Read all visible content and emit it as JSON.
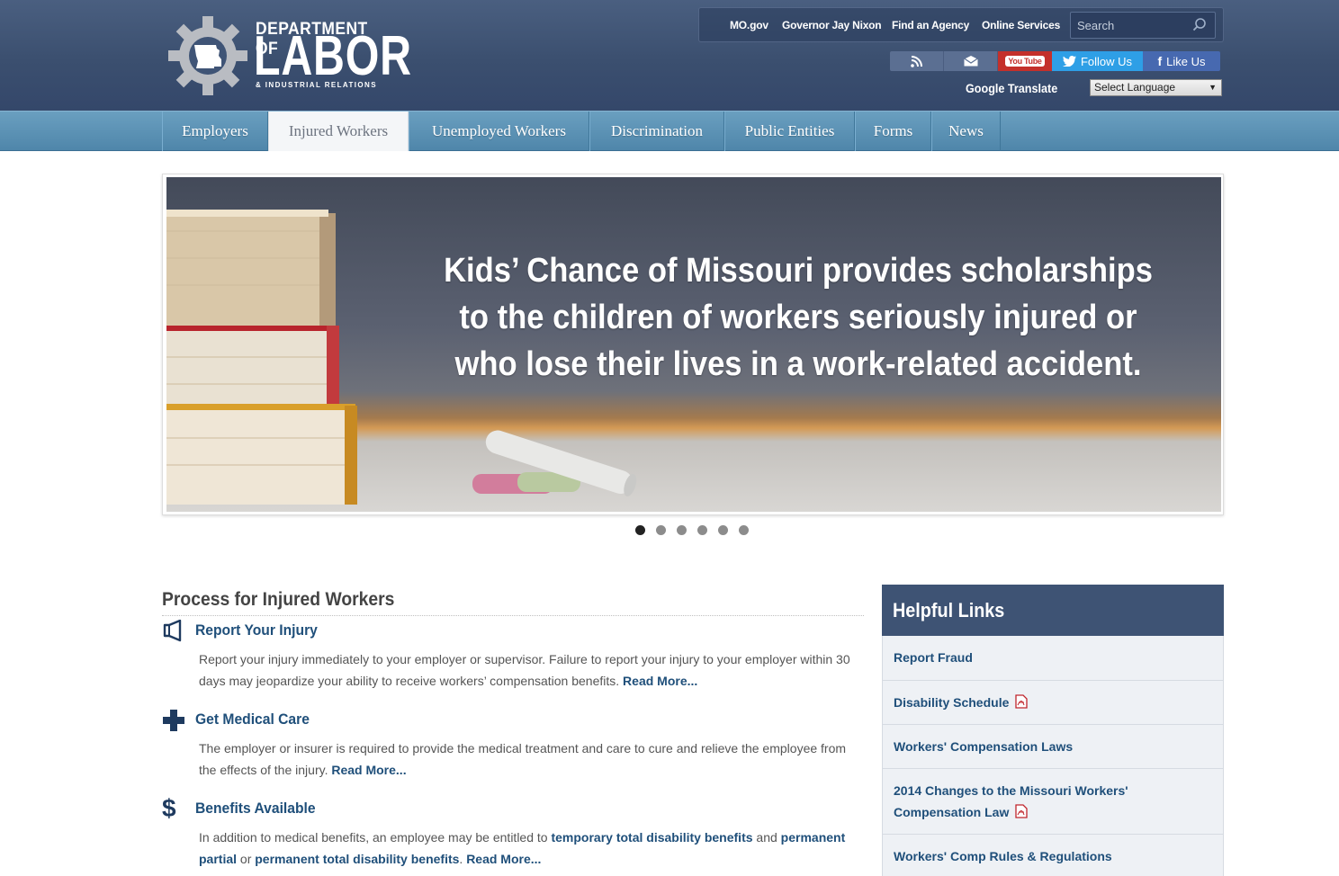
{
  "header": {
    "logo": {
      "line1": "DEPARTMENT OF",
      "line2": "LABOR",
      "line3": "& INDUSTRIAL RELATIONS"
    },
    "top_links": [
      "MO.gov",
      "Governor Jay Nixon",
      "Find an Agency",
      "Online Services"
    ],
    "search": {
      "placeholder": "Search"
    },
    "social": {
      "youtube_label": "You Tube",
      "twitter_label": "Follow Us",
      "facebook_label": "Like Us"
    },
    "translate": {
      "label": "Google Translate",
      "select_value": "Select Language"
    }
  },
  "nav": {
    "items": [
      "Employers",
      "Injured Workers",
      "Unemployed Workers",
      "Discrimination",
      "Public Entities",
      "Forms",
      "News"
    ],
    "active_index": 1
  },
  "slider": {
    "text_lines": [
      "Kids’ Chance of Missouri provides scholarships",
      "to the children of workers seriously injured or",
      "who lose their lives in a work-related accident."
    ],
    "slide_count": 6,
    "active_slide": 1
  },
  "main": {
    "title": "Process for Injured Workers",
    "items": [
      {
        "icon": "megaphone-icon",
        "heading": "Report Your Injury",
        "body": "Report your injury immediately to your employer or supervisor. Failure to report your injury to your employer within 30 days may jeopardize your ability to receive workers’ compensation benefits. ",
        "read_more": "Read More..."
      },
      {
        "icon": "medical-cross-icon",
        "heading": "Get Medical Care",
        "body": "The employer or insurer is required to provide the medical treatment and care to cure and relieve the employee from the effects of the injury. ",
        "read_more": "Read More..."
      },
      {
        "icon": "dollar-icon",
        "heading": "Benefits Available",
        "body_pre": "In addition to medical benefits, an employee may be entitled to ",
        "link1": "temporary total disability benefits",
        "body_mid1": " and ",
        "link2": "permanent partial",
        "body_mid2": " or ",
        "link3": "permanent total disability benefits",
        "body_end": ". ",
        "read_more": "Read More..."
      }
    ]
  },
  "sidebar": {
    "title": "Helpful Links",
    "links": [
      {
        "label": "Report Fraud",
        "pdf": false
      },
      {
        "label": "Disability Schedule",
        "pdf": true
      },
      {
        "label": "Workers' Compensation Laws",
        "pdf": false
      },
      {
        "label": "2014 Changes to the Missouri Workers' Compensation Law",
        "pdf": true
      },
      {
        "label": "Workers' Comp Rules & Regulations",
        "pdf": false
      }
    ]
  },
  "colors": {
    "header_bg": "#3b4f6f",
    "nav_bg": "#5a90b4",
    "link_blue": "#1f4f7a",
    "sidebar_head": "#3e5374"
  }
}
